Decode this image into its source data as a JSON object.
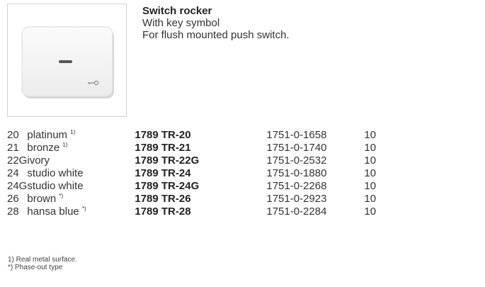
{
  "heading": {
    "title": "Switch rocker",
    "line1": "With key symbol",
    "line2": "For flush mounted push switch."
  },
  "variants": [
    {
      "code": "20",
      "name": "platinum",
      "mark": "1)",
      "article": "1789 TR-20",
      "order_no": "1751-0-1658",
      "pack": "10"
    },
    {
      "code": "21",
      "name": "bronze",
      "mark": "1)",
      "article": "1789 TR-21",
      "order_no": "1751-0-1740",
      "pack": "10"
    },
    {
      "code": "22G",
      "name": "ivory",
      "mark": "",
      "article": "1789 TR-22G",
      "order_no": "1751-0-2532",
      "pack": "10"
    },
    {
      "code": "24",
      "name": "studio white",
      "mark": "",
      "article": "1789 TR-24",
      "order_no": "1751-0-1880",
      "pack": "10"
    },
    {
      "code": "24G",
      "name": "studio white",
      "mark": "",
      "article": "1789 TR-24G",
      "order_no": "1751-0-2268",
      "pack": "10"
    },
    {
      "code": "26",
      "name": "brown",
      "mark": "*)",
      "article": "1789 TR-26",
      "order_no": "1751-0-2923",
      "pack": "10"
    },
    {
      "code": "28",
      "name": "hansa blue",
      "mark": "*)",
      "article": "1789 TR-28",
      "order_no": "1751-0-2284",
      "pack": "10"
    }
  ],
  "footnotes": {
    "note1": "1)  Real metal surface.",
    "note2": "*)  Phase-out type"
  },
  "icons": {
    "product_image": "switch-rocker-with-key-symbol",
    "key_symbol": "key-icon"
  }
}
